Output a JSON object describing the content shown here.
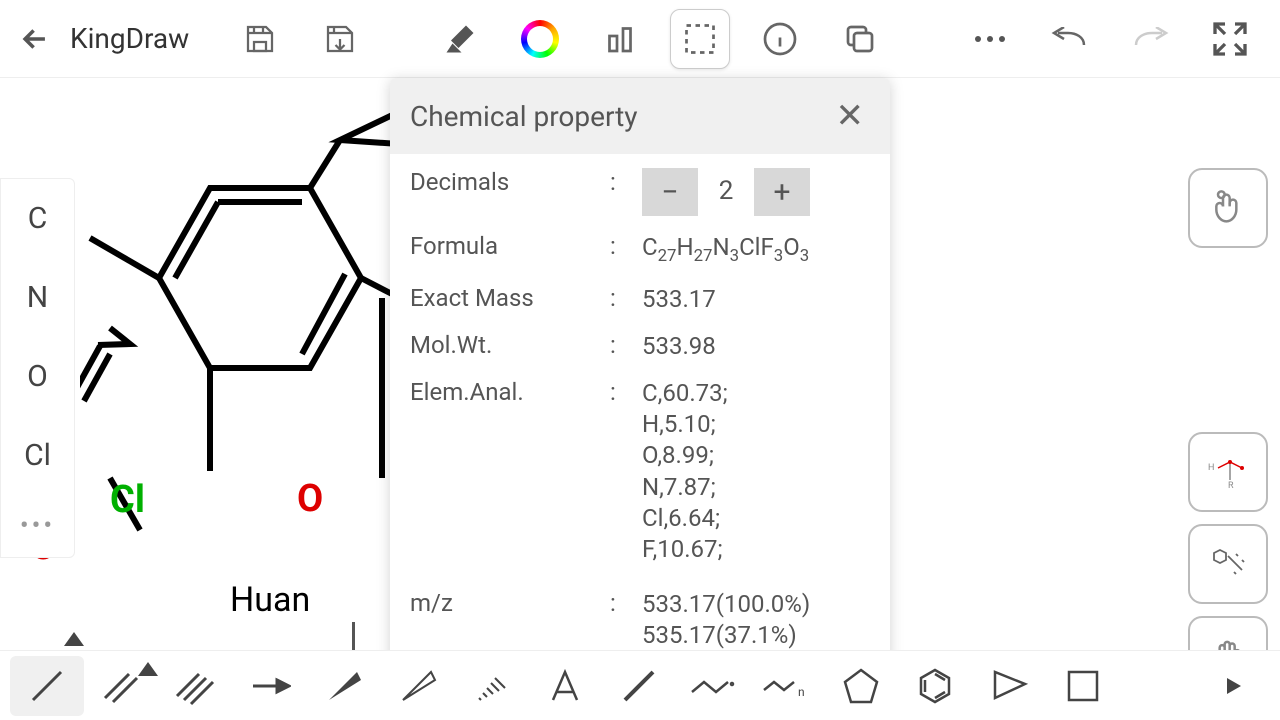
{
  "app": {
    "title": "KingDraw"
  },
  "left_palette": {
    "elements": [
      "C",
      "N",
      "O",
      "Cl"
    ]
  },
  "structure": {
    "cl_label": "Cl",
    "o_label": "O",
    "huan_label": "Huan"
  },
  "modal": {
    "title": "Chemical property",
    "decimals_label": "Decimals",
    "decimals_value": "2",
    "minus": "−",
    "plus": "+",
    "formula_label": "Formula",
    "formula_value": "C27H27N3ClF3O3",
    "exact_mass_label": "Exact Mass",
    "exact_mass_value": "533.17",
    "mol_wt_label": "Mol.Wt.",
    "mol_wt_value": "533.98",
    "elem_anal_label": "Elem.Anal.",
    "elem_anal_value": "C,60.73;\nH,5.10;\nO,8.99;\nN,7.87;\nCl,6.64;\nF,10.67;",
    "mz_label": "m/z",
    "mz_value": "533.17(100.0%)\n535.17(37.1%)"
  }
}
